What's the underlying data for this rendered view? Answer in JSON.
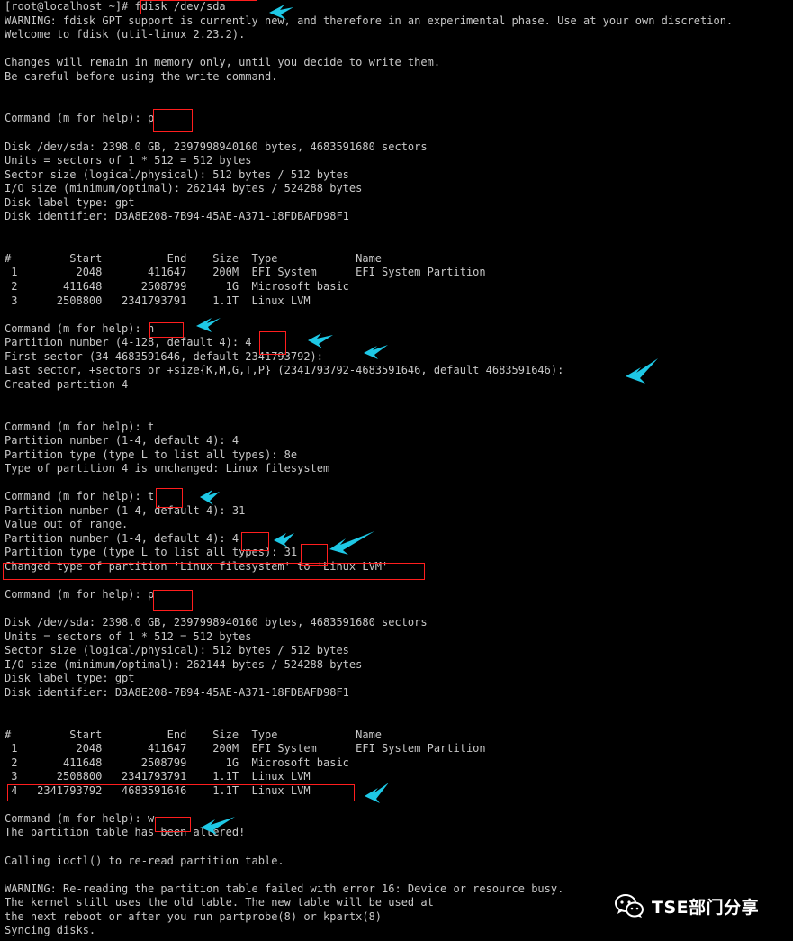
{
  "terminal": {
    "lines": [
      "[root@localhost ~]# fdisk /dev/sda",
      "WARNING: fdisk GPT support is currently new, and therefore in an experimental phase. Use at your own discretion.",
      "Welcome to fdisk (util-linux 2.23.2).",
      "",
      "Changes will remain in memory only, until you decide to write them.",
      "Be careful before using the write command.",
      "",
      "",
      "Command (m for help): p",
      "",
      "Disk /dev/sda: 2398.0 GB, 2397998940160 bytes, 4683591680 sectors",
      "Units = sectors of 1 * 512 = 512 bytes",
      "Sector size (logical/physical): 512 bytes / 512 bytes",
      "I/O size (minimum/optimal): 262144 bytes / 524288 bytes",
      "Disk label type: gpt",
      "Disk identifier: D3A8E208-7B94-45AE-A371-18FDBAFD98F1",
      "",
      "",
      "#         Start          End    Size  Type            Name",
      " 1         2048       411647    200M  EFI System      EFI System Partition",
      " 2       411648      2508799      1G  Microsoft basic",
      " 3      2508800   2341793791    1.1T  Linux LVM",
      "",
      "Command (m for help): n",
      "Partition number (4-128, default 4): 4",
      "First sector (34-4683591646, default 2341793792):",
      "Last sector, +sectors or +size{K,M,G,T,P} (2341793792-4683591646, default 4683591646):",
      "Created partition 4",
      "",
      "",
      "Command (m for help): t",
      "Partition number (1-4, default 4): 4",
      "Partition type (type L to list all types): 8e",
      "Type of partition 4 is unchanged: Linux filesystem",
      "",
      "Command (m for help): t",
      "Partition number (1-4, default 4): 31",
      "Value out of range.",
      "Partition number (1-4, default 4): 4",
      "Partition type (type L to list all types): 31",
      "Changed type of partition 'Linux filesystem' to 'Linux LVM'",
      "",
      "Command (m for help): p",
      "",
      "Disk /dev/sda: 2398.0 GB, 2397998940160 bytes, 4683591680 sectors",
      "Units = sectors of 1 * 512 = 512 bytes",
      "Sector size (logical/physical): 512 bytes / 512 bytes",
      "I/O size (minimum/optimal): 262144 bytes / 524288 bytes",
      "Disk label type: gpt",
      "Disk identifier: D3A8E208-7B94-45AE-A371-18FDBAFD98F1",
      "",
      "",
      "#         Start          End    Size  Type            Name",
      " 1         2048       411647    200M  EFI System      EFI System Partition",
      " 2       411648      2508799      1G  Microsoft basic",
      " 3      2508800   2341793791    1.1T  Linux LVM",
      " 4   2341793792   4683591646    1.1T  Linux LVM",
      "",
      "Command (m for help): w",
      "The partition table has been altered!",
      "",
      "Calling ioctl() to re-read partition table.",
      "",
      "WARNING: Re-reading the partition table failed with error 16: Device or resource busy.",
      "The kernel still uses the old table. The new table will be used at",
      "the next reboot or after you run partprobe(8) or kpartx(8)",
      "Syncing disks."
    ]
  },
  "watermark": {
    "text": "TSE部门分享",
    "icon": "wechat-icon"
  },
  "colors": {
    "background": "#000000",
    "text": "#c8c8c8",
    "highlight_box": "#ff1e1e",
    "arrow": "#1ec8e6"
  }
}
